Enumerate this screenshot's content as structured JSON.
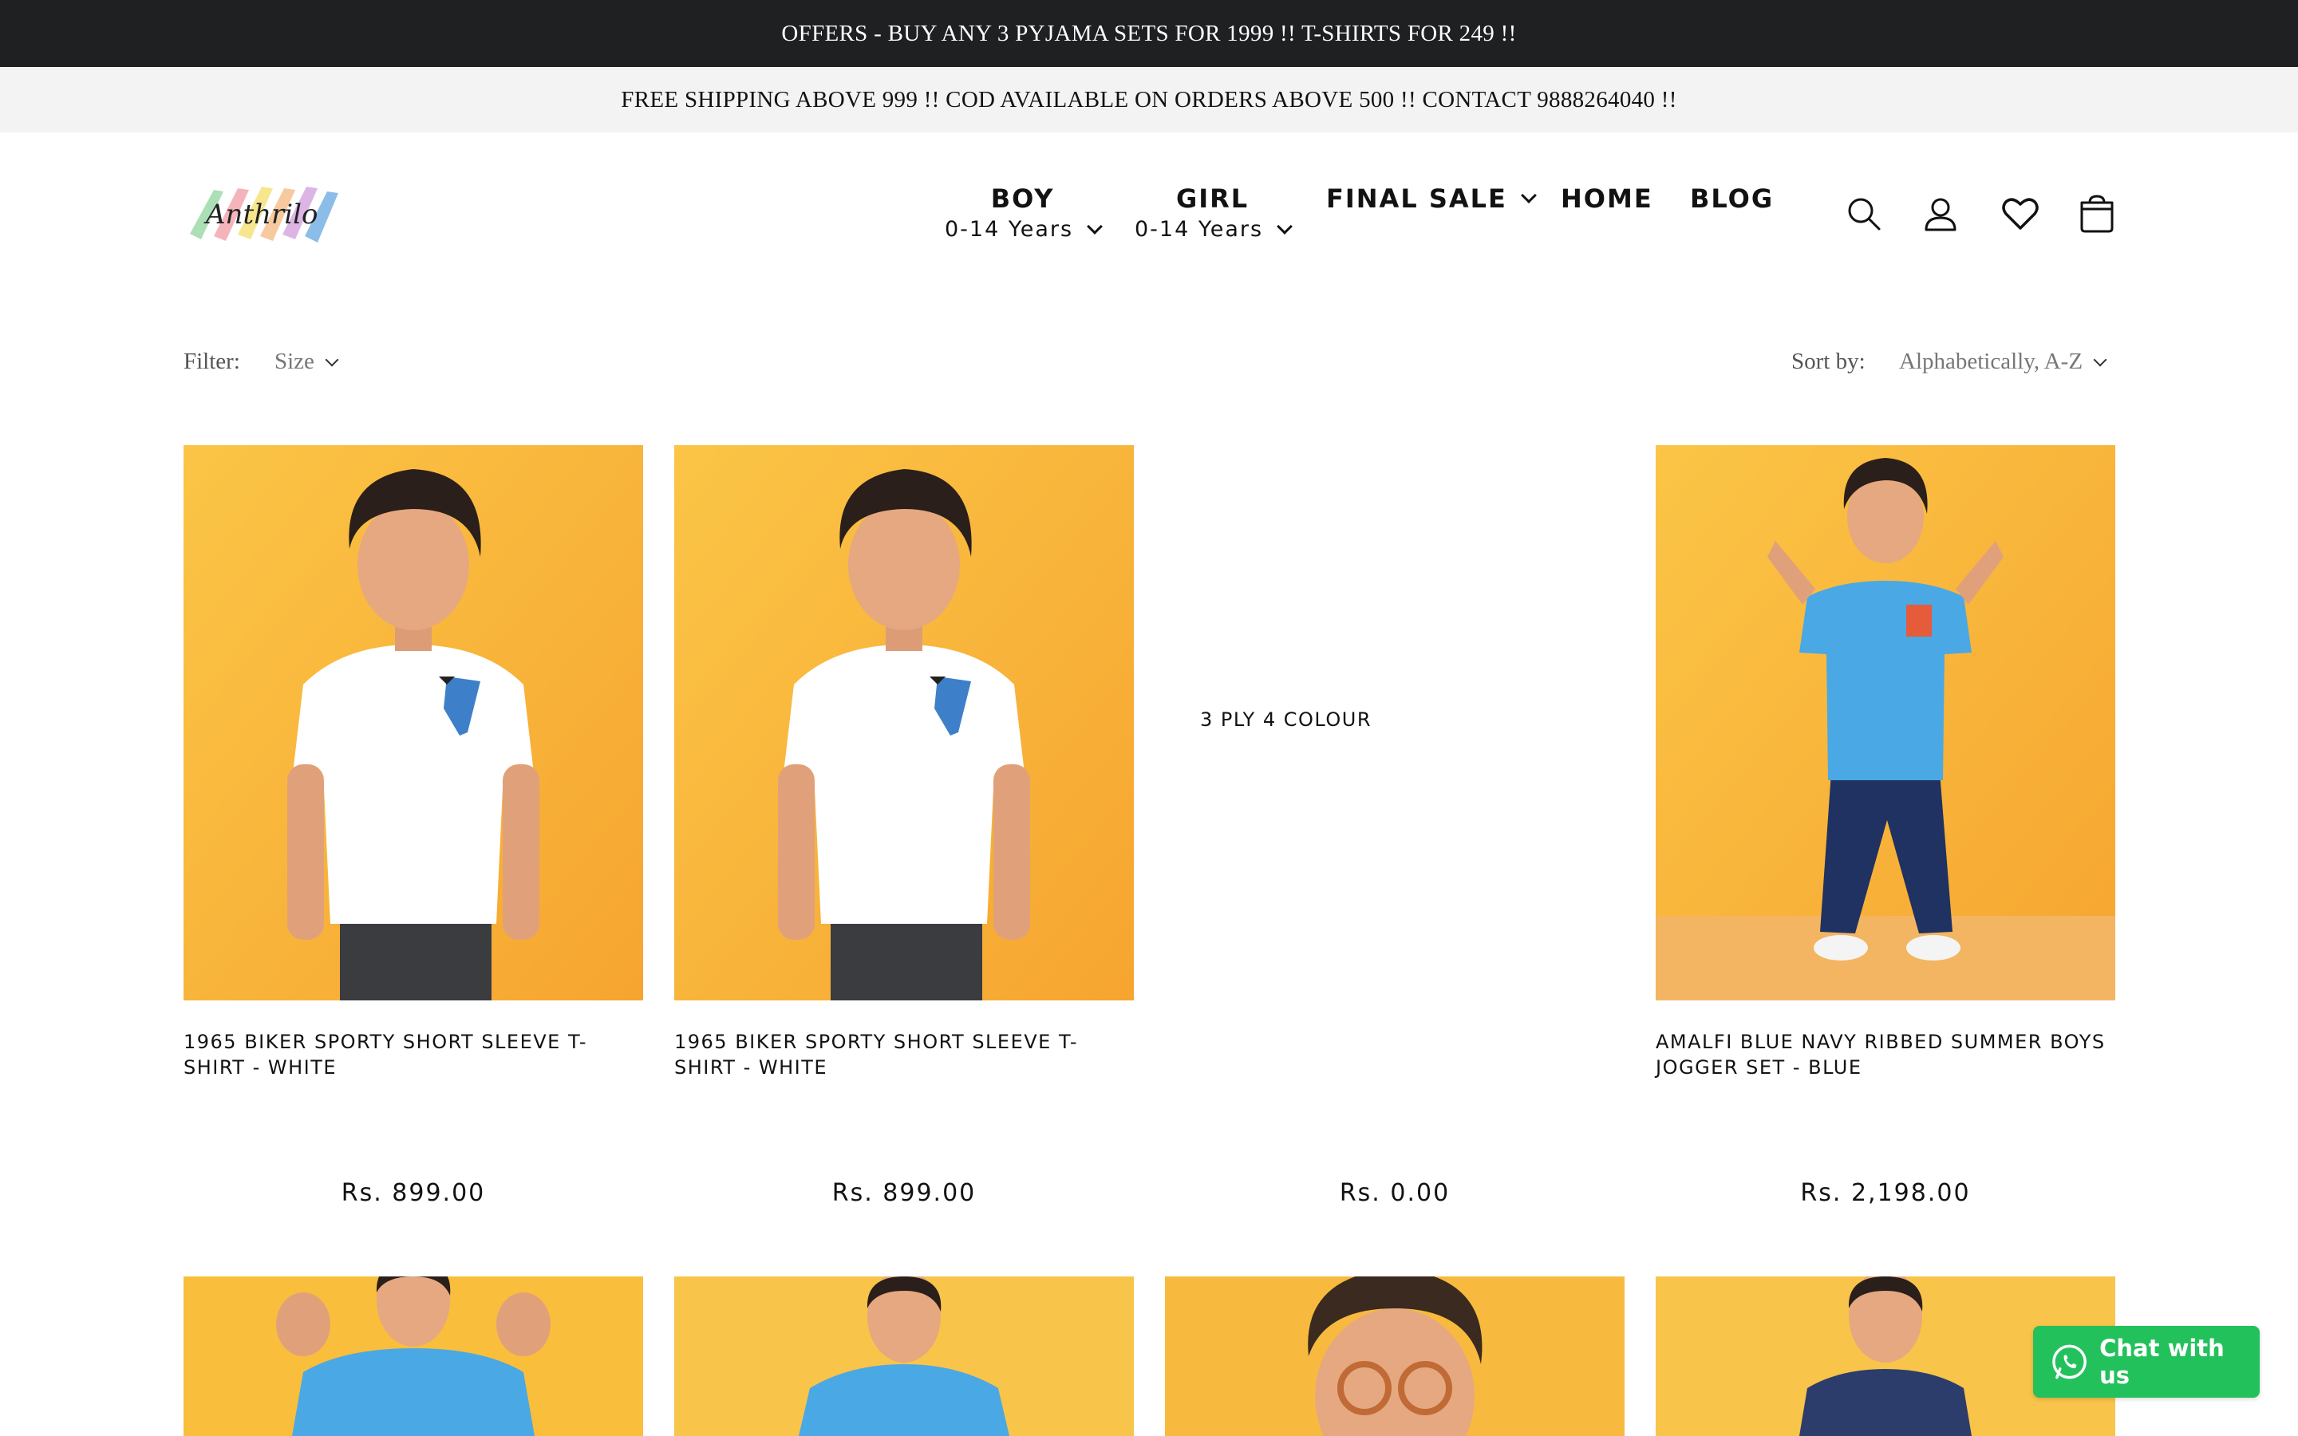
{
  "announcement": {
    "offers": "OFFERS - BUY ANY 3 PYJAMA SETS FOR 1999 !! T-SHIRTS FOR 249 !!",
    "shipping": "FREE SHIPPING ABOVE 999 !! COD AVAILABLE ON ORDERS ABOVE 500 !! CONTACT 9888264040 !!"
  },
  "header": {
    "logo_text": "Anthrilo",
    "nav": [
      {
        "label": "BOY",
        "sub": "0-14 Years"
      },
      {
        "label": "GIRL",
        "sub": "0-14 Years"
      },
      {
        "label": "FINAL SALE"
      },
      {
        "label": "HOME"
      },
      {
        "label": "BLOG"
      }
    ],
    "icons": [
      "search-icon",
      "account-icon",
      "wishlist-heart-icon",
      "cart-icon"
    ]
  },
  "filters": {
    "filter_label": "Filter:",
    "size_label": "Size",
    "sort_label": "Sort by:",
    "sort_value": "Alphabetically, A-Z"
  },
  "products": [
    {
      "title": "1965 BIKER SPORTY SHORT SLEEVE T-SHIRT - WHITE",
      "price": "Rs. 899.00",
      "image": "boy-white-tshirt"
    },
    {
      "title": "1965 BIKER SPORTY SHORT SLEEVE T-SHIRT - WHITE",
      "price": "Rs. 899.00",
      "image": "boy-white-tshirt"
    },
    {
      "title": "",
      "placeholder": "3 PLY 4 COLOUR",
      "price": "Rs. 0.00",
      "image": "none"
    },
    {
      "title": "AMALFI BLUE NAVY RIBBED SUMMER BOYS JOGGER SET - BLUE",
      "price": "Rs. 2,198.00",
      "image": "boy-blue-jogger-set"
    }
  ],
  "chat": {
    "label": "Chat with us",
    "icon": "whatsapp-icon",
    "color": "#23c15c"
  },
  "colors": {
    "top_bar": "#1f2021",
    "second_bar": "#f3f3f3",
    "product_bg": "#f7b33a"
  }
}
